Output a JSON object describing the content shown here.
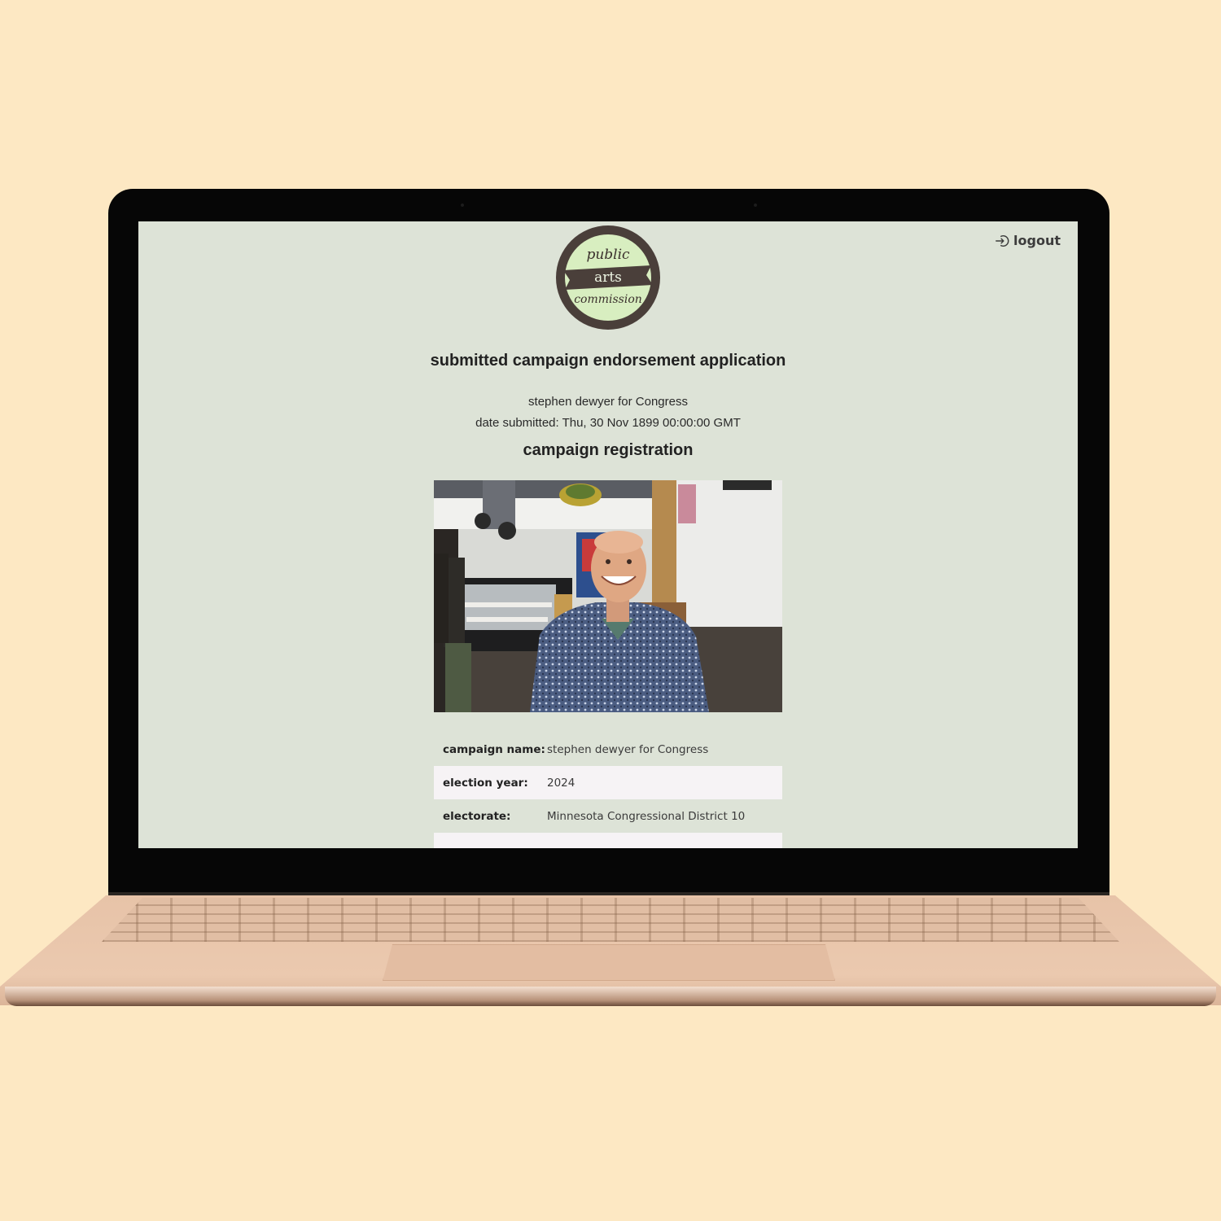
{
  "header": {
    "logout_label": "logout",
    "logo_lines": [
      "public",
      "arts",
      "commission"
    ]
  },
  "main": {
    "heading": "submitted campaign endorsement application",
    "campaign_title": "stephen dewyer for Congress",
    "date_submitted": "date submitted: Thu, 30 Nov 1899 00:00:00 GMT",
    "section_heading": "campaign registration"
  },
  "details": [
    {
      "label": "campaign name:",
      "value": "stephen dewyer for Congress"
    },
    {
      "label": "election year:",
      "value": "2024"
    },
    {
      "label": "electorate:",
      "value": "Minnesota Congressional District 10"
    }
  ],
  "colors": {
    "page_background": "#fde8c3",
    "screen_background": "#dde3d7",
    "logo_ring": "#4a3f3a",
    "logo_fill": "#d8eec0",
    "row_alt": "#f6f3f5"
  },
  "icons": [
    "logout-icon"
  ]
}
